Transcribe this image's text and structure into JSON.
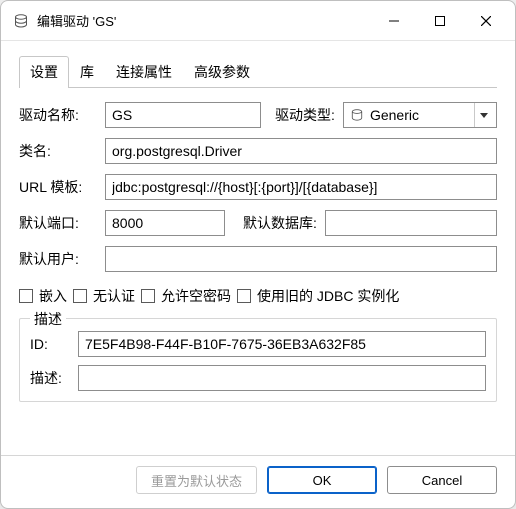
{
  "window": {
    "title": "编辑驱动 'GS'"
  },
  "tabs": [
    "设置",
    "库",
    "连接属性",
    "高级参数"
  ],
  "active_tab_index": 0,
  "labels": {
    "driver_name": "驱动名称:",
    "driver_type": "驱动类型:",
    "class_name": "类名:",
    "url_template": "URL 模板:",
    "default_port": "默认端口:",
    "default_db": "默认数据库:",
    "default_user": "默认用户:"
  },
  "fields": {
    "driver_name": "GS",
    "driver_type": "Generic",
    "class_name": "org.postgresql.Driver",
    "url_template": "jdbc:postgresql://{host}[:{port}]/[{database}]",
    "default_port": "8000",
    "default_db": "",
    "default_user": ""
  },
  "checkboxes": {
    "embed": "嵌入",
    "no_auth": "无认证",
    "allow_empty_pw": "允许空密码",
    "use_legacy_jdbc": "使用旧的 JDBC 实例化"
  },
  "description_group": {
    "legend": "描述",
    "id_label": "ID:",
    "id_value": "7E5F4B98-F44F-B10F-7675-36EB3A632F85",
    "desc_label": "描述:",
    "desc_value": ""
  },
  "footer": {
    "reset": "重置为默认状态",
    "ok": "OK",
    "cancel": "Cancel"
  }
}
